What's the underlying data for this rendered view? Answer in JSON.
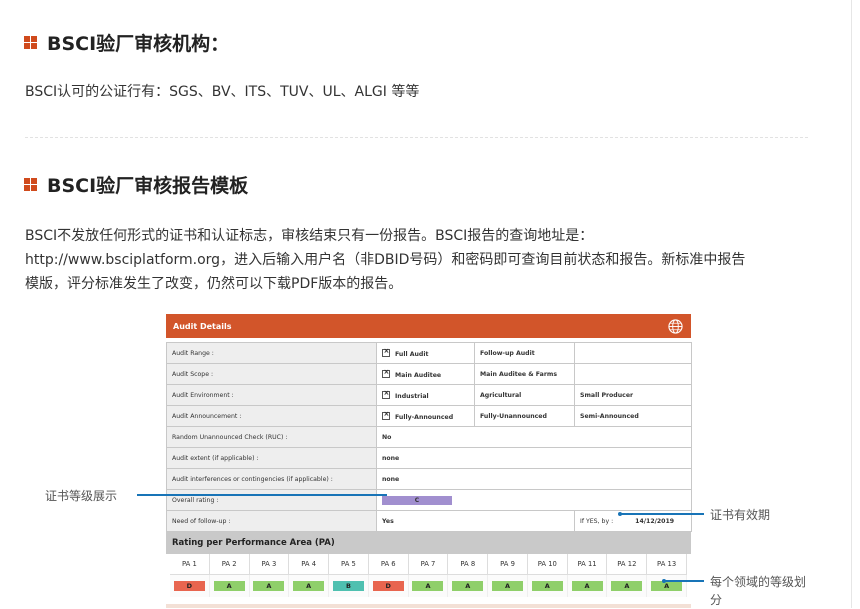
{
  "section1": {
    "title": "BSCI验厂审核机构：",
    "text": "BSCI认可的公证行有：SGS、BV、ITS、TUV、UL、ALGI 等等"
  },
  "section2": {
    "title": "BSCI验厂审核报告模板",
    "lines": [
      "BSCI不发放任何形式的证书和认证标志，审核结束只有一份报告。BSCI报告的查询地址是：",
      "http://www.bsciplatform.org，进入后输入用户名（非DBID号码）和密码即可查询目前状态和报告。新标准中报告",
      "模版，评分标准发生了改变，仍然可以下载PDF版本的报告。"
    ]
  },
  "figure": {
    "header": "Audit Details",
    "rows": {
      "range": {
        "label": "Audit Range :",
        "c1": "Full Audit",
        "c2": "Follow-up Audit"
      },
      "scope": {
        "label": "Audit Scope :",
        "c1": "Main Auditee",
        "c2": "Main Auditee & Farms"
      },
      "env": {
        "label": "Audit Environment :",
        "c1": "Industrial",
        "c2": "Agricultural",
        "c3": "Small Producer"
      },
      "announce": {
        "label": "Audit Announcement :",
        "c1": "Fully-Announced",
        "c2": "Fully-Unannounced",
        "c3": "Semi-Announced"
      },
      "ruc": {
        "label": "Random Unannounced Check (RUC) :",
        "value": "No"
      },
      "extent": {
        "label": "Audit extent (if applicable) :",
        "value": "none"
      },
      "interf": {
        "label": "Audit interferences or contingencies (if applicable) :",
        "value": "none"
      },
      "overall": {
        "label": "Overall rating :",
        "value": "C"
      },
      "followup": {
        "label": "Need of follow-up :",
        "value": "Yes",
        "ifyes": "If YES, by :",
        "date": "14/12/2019"
      }
    },
    "pa": {
      "title": "Rating per Performance Area (PA)",
      "headers": [
        "PA 1",
        "PA 2",
        "PA 3",
        "PA 4",
        "PA 5",
        "PA 6",
        "PA 7",
        "PA 8",
        "PA 9",
        "PA 10",
        "PA 11",
        "PA 12",
        "PA 13"
      ],
      "ratings": [
        "D",
        "A",
        "A",
        "A",
        "B",
        "D",
        "A",
        "A",
        "A",
        "A",
        "A",
        "A",
        "A"
      ]
    },
    "colors": {
      "header": "#d2552a",
      "A": "#8fcf6a",
      "B": "#4fc0b0",
      "D": "#e8654f",
      "rating": "#a18fcf"
    }
  },
  "annotations": {
    "cert_level": "证书等级展示",
    "validity": "证书有效期",
    "area_rating_line1": "每个领域的等级划",
    "area_rating_line2": "分"
  }
}
